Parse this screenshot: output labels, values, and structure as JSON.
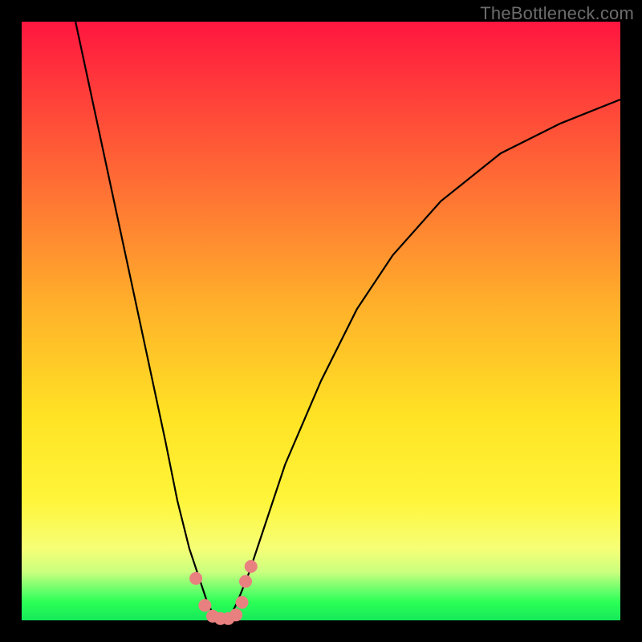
{
  "watermark": "TheBottleneck.com",
  "chart_data": {
    "type": "line",
    "title": "",
    "xlabel": "",
    "ylabel": "",
    "xlim": [
      0,
      100
    ],
    "ylim": [
      0,
      100
    ],
    "grid": false,
    "legend": false,
    "series": [
      {
        "name": "bottleneck-curve",
        "x": [
          9,
          12,
          15,
          18,
          21,
          24,
          26,
          28,
          30,
          31,
          32,
          33,
          34,
          35,
          36,
          38,
          40,
          44,
          50,
          56,
          62,
          70,
          80,
          90,
          100
        ],
        "y": [
          100,
          86,
          72,
          58,
          44,
          30,
          20,
          12,
          6,
          3,
          1,
          0,
          0,
          1,
          3,
          8,
          14,
          26,
          40,
          52,
          61,
          70,
          78,
          83,
          87
        ]
      },
      {
        "name": "highlight-dots",
        "x": [
          29.1,
          30.6,
          31.9,
          33.2,
          34.5,
          35.8,
          36.8,
          37.4,
          38.3
        ],
        "y": [
          7.0,
          2.5,
          0.7,
          0.3,
          0.3,
          0.9,
          3.0,
          6.5,
          9.0
        ]
      }
    ],
    "colors": {
      "curve": "#000000",
      "dots": "#e98080"
    }
  }
}
